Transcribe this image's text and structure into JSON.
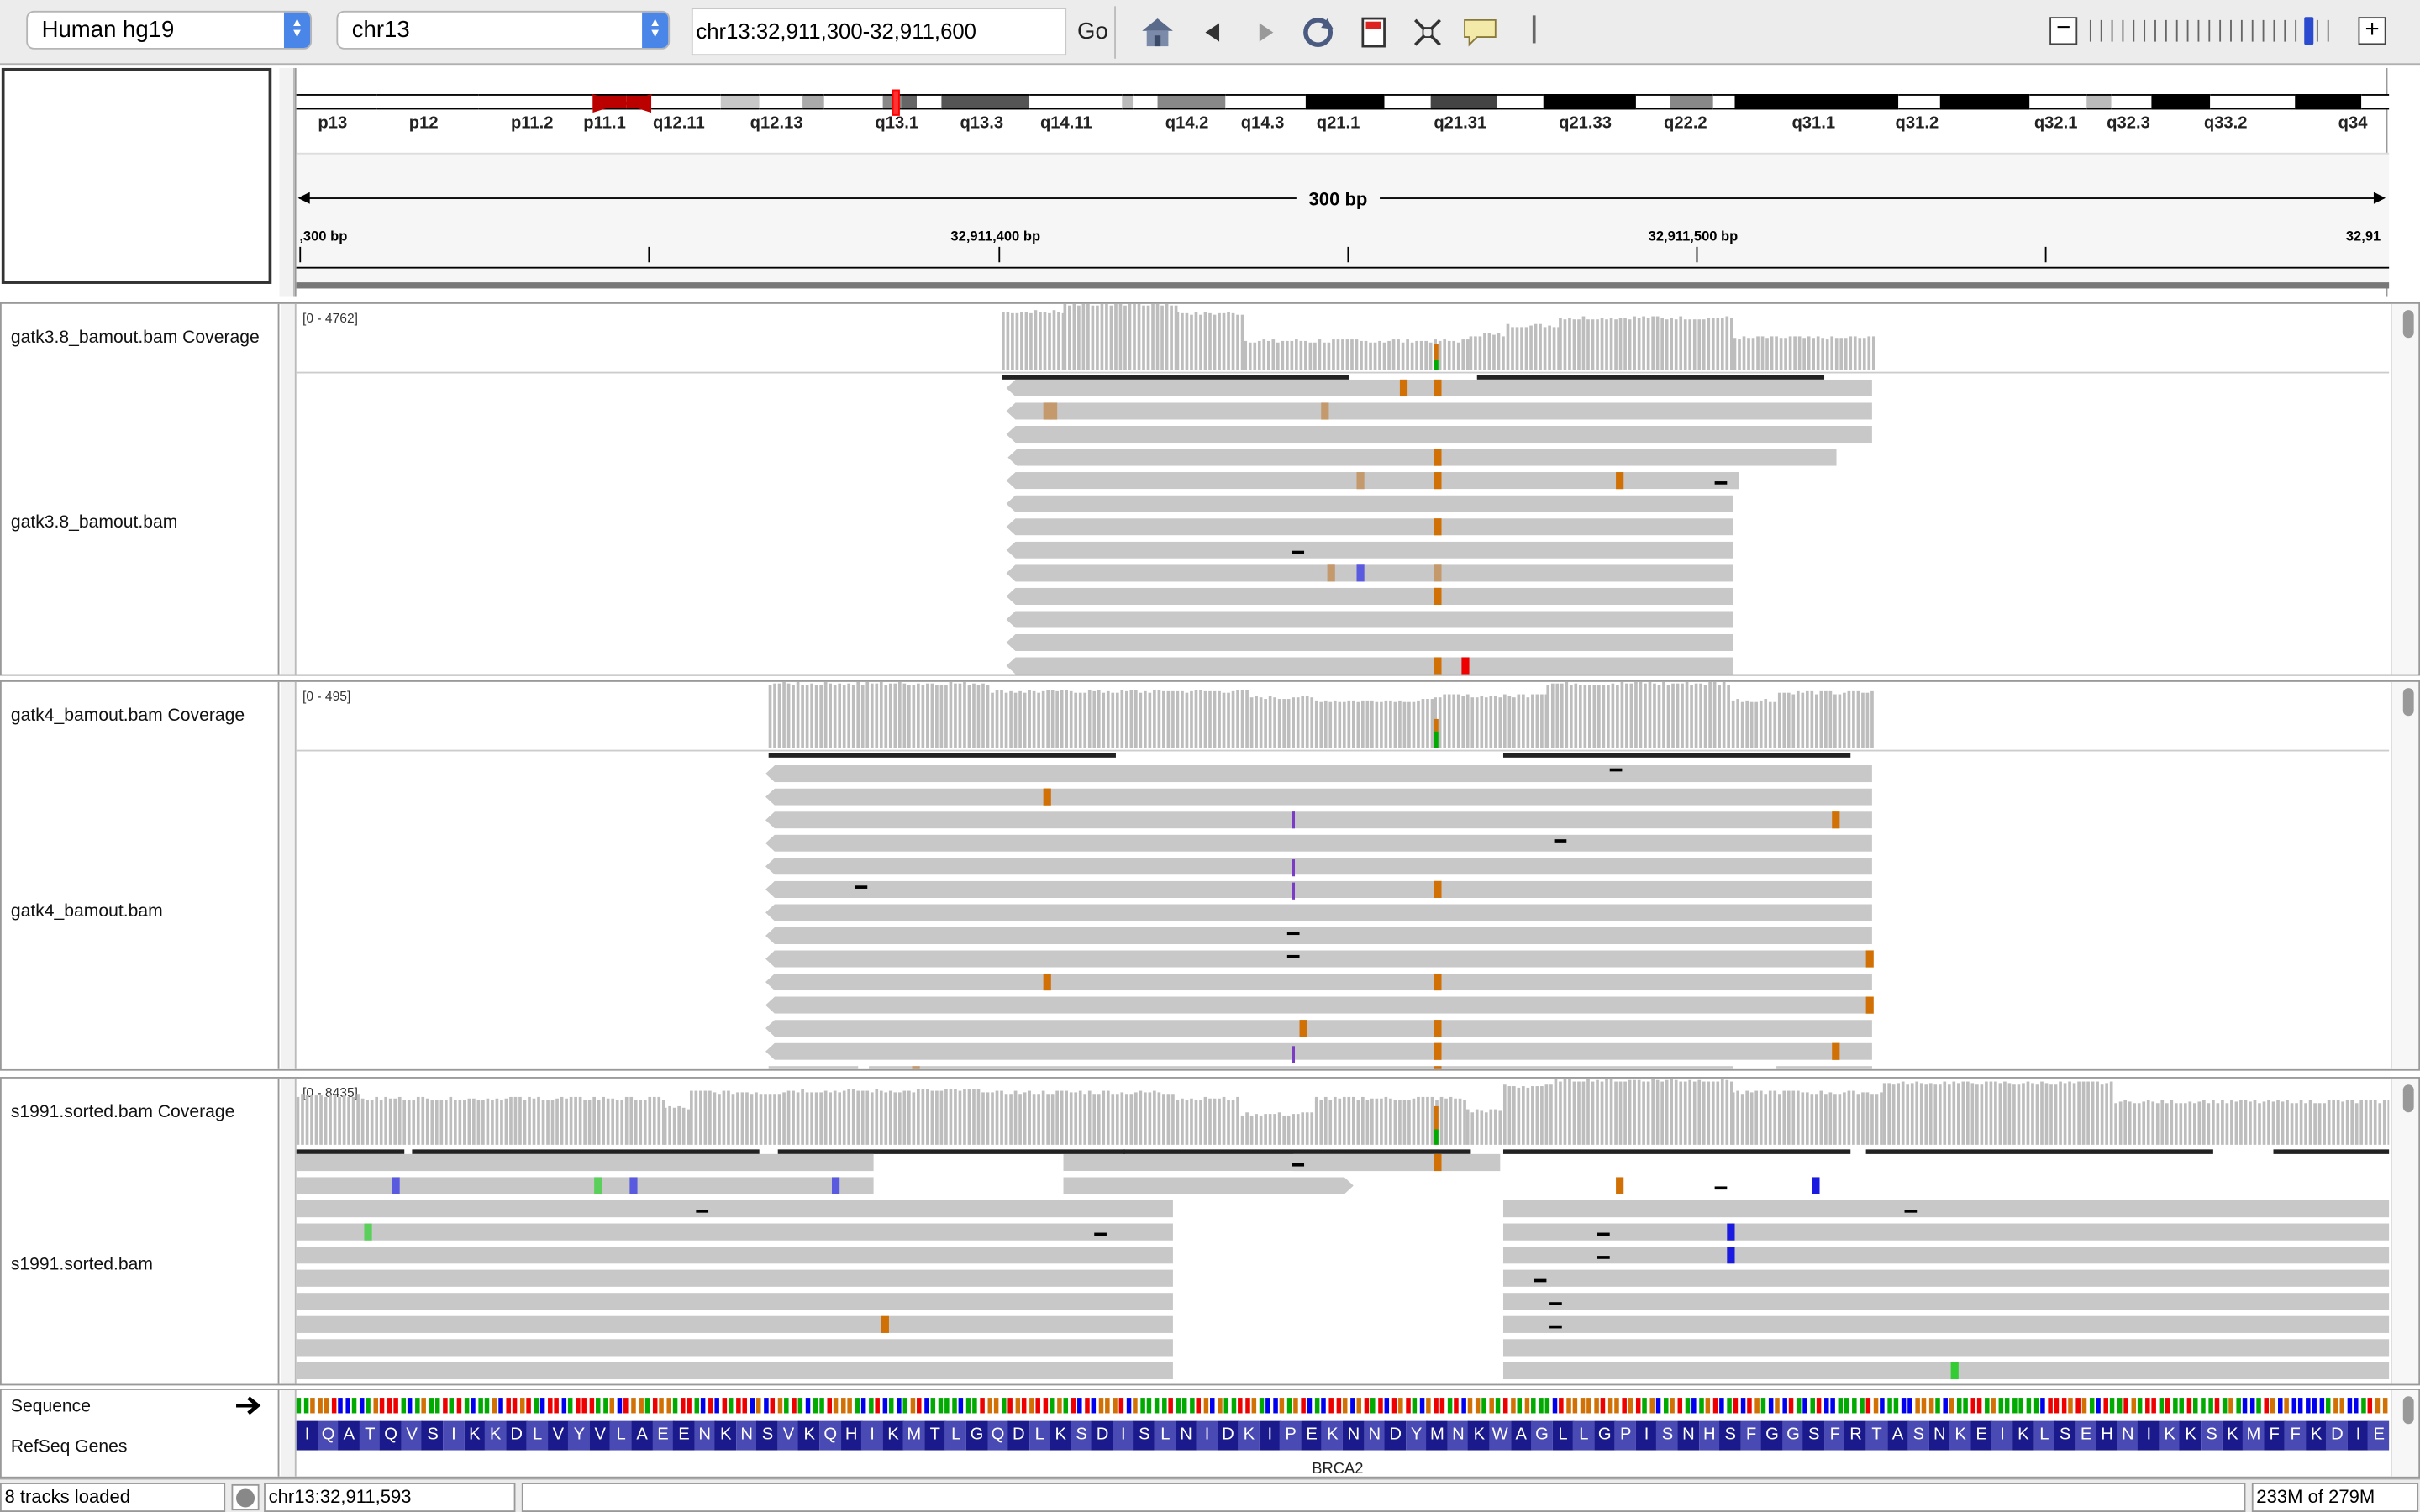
{
  "toolbar": {
    "genome": "Human hg19",
    "chromosome": "chr13",
    "locus": "chr13:32,911,300-32,911,600",
    "go_label": "Go",
    "icons": [
      "home-icon",
      "back-icon",
      "forward-icon",
      "refresh-icon",
      "roi-icon",
      "resize-icon",
      "popup-info-icon"
    ]
  },
  "ideogram": {
    "bands": [
      "p13",
      "p12",
      "p11.2",
      "p11.1",
      "q12.11",
      "q12.13",
      "q13.1",
      "q13.3",
      "q14.11",
      "q14.2",
      "q14.3",
      "q21.1",
      "q21.31",
      "q21.33",
      "q22.2",
      "q31.1",
      "q31.2",
      "q32.1",
      "q32.3",
      "q33.2",
      "q34"
    ]
  },
  "ruler": {
    "span": "300 bp",
    "left_label": ",300 bp",
    "mid1_label": "32,911,400 bp",
    "mid2_label": "32,911,500 bp",
    "right_label": "32,91"
  },
  "tracks": {
    "gatk38_cov": {
      "name": "gatk3.8_bamout.bam Coverage",
      "range": "[0 - 4762]"
    },
    "gatk38_bam": {
      "name": "gatk3.8_bamout.bam"
    },
    "gatk4_cov": {
      "name": "gatk4_bamout.bam Coverage",
      "range": "[0 - 495]"
    },
    "gatk4_bam": {
      "name": "gatk4_bamout.bam"
    },
    "s1991_cov": {
      "name": "s1991.sorted.bam Coverage",
      "range": "[0 - 8435]"
    },
    "s1991_bam": {
      "name": "s1991.sorted.bam"
    },
    "sequence": {
      "name": "Sequence"
    },
    "refseq": {
      "name": "RefSeq Genes",
      "gene": "BRCA2"
    }
  },
  "amino_acids": "IQATQVSIKKDLVYVLAEENKNSVKQHIKMTLGQDLKSDISLNIDKIPEKNNDYMNKWAGLLGPISNHSFGGSFRTASNKEIKLSEHNIKKSKMFFKDIE",
  "status": {
    "tracks_loaded": "8 tracks loaded",
    "position": "chr13:32,911,593",
    "memory": "233M of 279M"
  },
  "colors": {
    "A": "#00aa00",
    "C": "#0000ee",
    "G": "#d17105",
    "T": "#ee0000",
    "aa_dark": "#1a1a8c",
    "aa_light": "#4a4ab4"
  }
}
